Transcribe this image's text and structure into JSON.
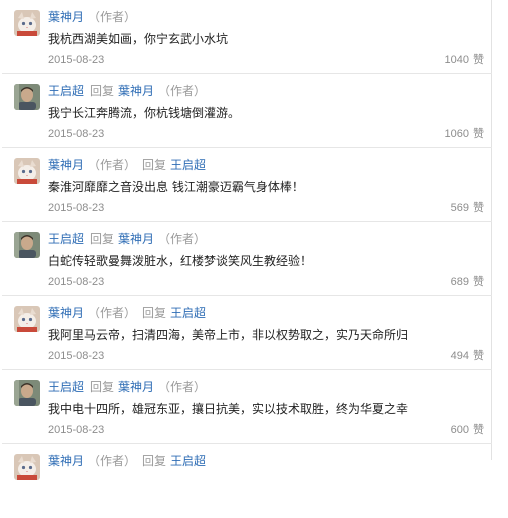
{
  "colors": {
    "name": "#2f6db5",
    "muted": "#9a9a9a",
    "text": "#222222"
  },
  "comments": [
    {
      "avatar": "cat-avatar",
      "name": "葉神月",
      "author_tag": "（作者）",
      "reply_word": "",
      "reply_to": "",
      "reply_to_tag": "",
      "text": "我杭西湖美如画，你宁玄武小水坑",
      "date": "2015-08-23",
      "likes": "1040",
      "likes_unit": "赞"
    },
    {
      "avatar": "man-avatar",
      "name": "王启超",
      "author_tag": "",
      "reply_word": "回复",
      "reply_to": "葉神月",
      "reply_to_tag": "（作者）",
      "text": "我宁长江奔腾流，你杭钱塘倒灌游。",
      "date": "2015-08-23",
      "likes": "1060",
      "likes_unit": "赞"
    },
    {
      "avatar": "cat-avatar",
      "name": "葉神月",
      "author_tag": "（作者）",
      "reply_word": "回复",
      "reply_to": "王启超",
      "reply_to_tag": "",
      "text": "秦淮河靡靡之音没出息 钱江潮豪迈霸气身体棒！",
      "date": "2015-08-23",
      "likes": "569",
      "likes_unit": "赞"
    },
    {
      "avatar": "man-avatar",
      "name": "王启超",
      "author_tag": "",
      "reply_word": "回复",
      "reply_to": "葉神月",
      "reply_to_tag": "（作者）",
      "text": "白蛇传轻歌曼舞泼脏水，红楼梦谈笑风生教经验！",
      "date": "2015-08-23",
      "likes": "689",
      "likes_unit": "赞"
    },
    {
      "avatar": "cat-avatar",
      "name": "葉神月",
      "author_tag": "（作者）",
      "reply_word": "回复",
      "reply_to": "王启超",
      "reply_to_tag": "",
      "text": "我阿里马云帝，扫清四海，美帝上市，非以权势取之，实乃天命所归",
      "date": "2015-08-23",
      "likes": "494",
      "likes_unit": "赞"
    },
    {
      "avatar": "man-avatar",
      "name": "王启超",
      "author_tag": "",
      "reply_word": "回复",
      "reply_to": "葉神月",
      "reply_to_tag": "（作者）",
      "text": "我中电十四所，雄冠东亚，攘日抗美，实以技术取胜，终为华夏之幸",
      "date": "2015-08-23",
      "likes": "600",
      "likes_unit": "赞"
    },
    {
      "avatar": "cat-avatar",
      "name": "葉神月",
      "author_tag": "（作者）",
      "reply_word": "回复",
      "reply_to": "王启超",
      "reply_to_tag": "",
      "text": "",
      "date": "",
      "likes": "",
      "likes_unit": ""
    }
  ]
}
